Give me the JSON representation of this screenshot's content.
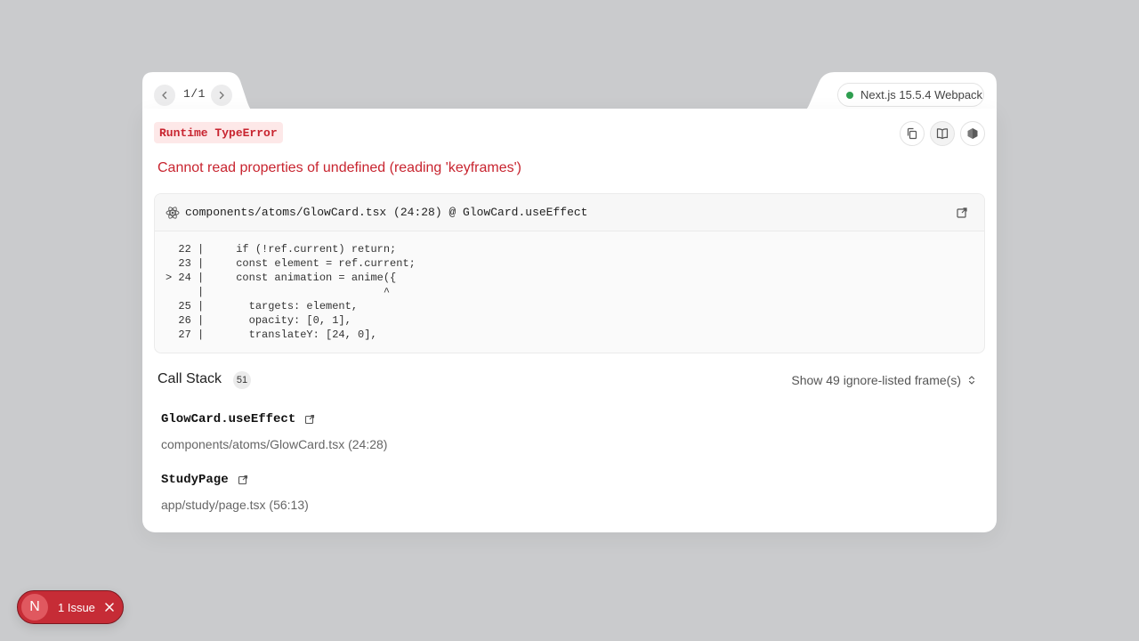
{
  "pager": {
    "text": "1/1"
  },
  "version": {
    "label": "Next.js 15.5.4 Webpack",
    "status_color": "#2e9e4f"
  },
  "error": {
    "type_label": "Runtime TypeError",
    "message": "Cannot read properties of undefined (reading 'keyframes')",
    "accent_color": "#c8242f"
  },
  "code_frame": {
    "file_label": "components/atoms/GlowCard.tsx (24:28) @ GlowCard.useEffect",
    "lines": [
      "  22 |     if (!ref.current) return;",
      "  23 |     const element = ref.current;",
      "> 24 |     const animation = anime({",
      "     |                            ^",
      "  25 |       targets: element,",
      "  26 |       opacity: [0, 1],",
      "  27 |       translateY: [24, 0],"
    ]
  },
  "call_stack": {
    "title": "Call Stack",
    "count": "51",
    "ignore_toggle_label": "Show 49 ignore-listed frame(s)",
    "frames": [
      {
        "name": "GlowCard.useEffect",
        "location": "components/atoms/GlowCard.tsx (24:28)"
      },
      {
        "name": "StudyPage",
        "location": "app/study/page.tsx (56:13)"
      }
    ]
  },
  "issues": {
    "logo_letter": "N",
    "label": "1 Issue"
  }
}
